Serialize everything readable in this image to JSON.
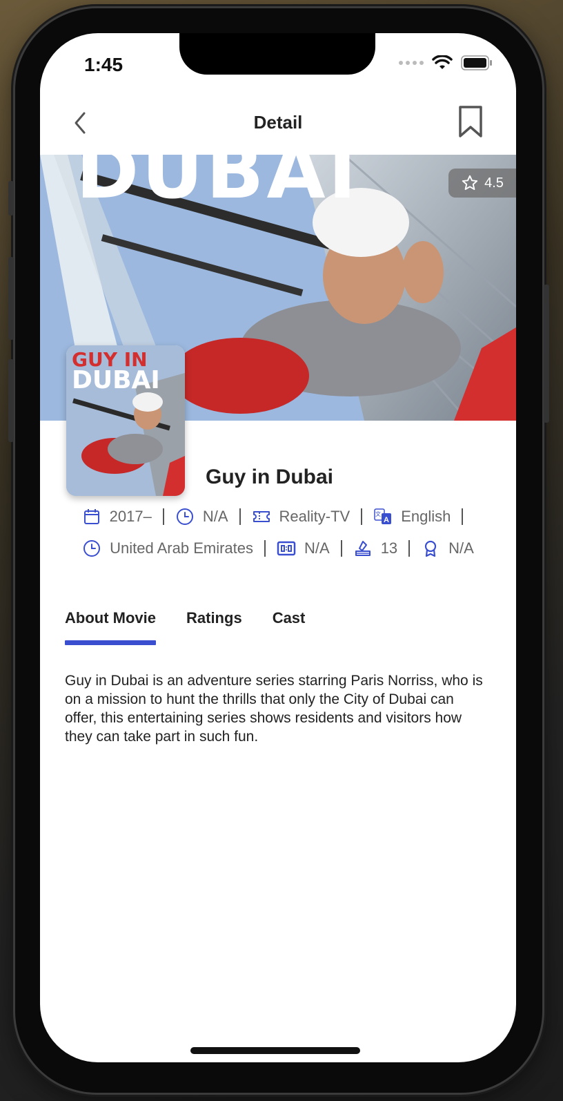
{
  "status": {
    "time": "1:45"
  },
  "nav": {
    "title": "Detail",
    "back_icon": "chevron-left-icon",
    "bookmark_icon": "bookmark-icon"
  },
  "hero": {
    "banner_text": "DUBAI"
  },
  "rating": {
    "value": "4.5",
    "icon": "star-outline-icon"
  },
  "poster": {
    "line1_red": "GUY",
    "line1_white": "IN",
    "line2": "DUBAI"
  },
  "show": {
    "title": "Guy in Dubai"
  },
  "meta": {
    "year": "2017–",
    "runtime": "N/A",
    "genre": "Reality-TV",
    "language": "English",
    "country": "United Arab Emirates",
    "score": "N/A",
    "votes": "13",
    "awards": "N/A"
  },
  "tabs": [
    {
      "label": "About Movie",
      "active": true
    },
    {
      "label": "Ratings",
      "active": false
    },
    {
      "label": "Cast",
      "active": false
    }
  ],
  "about": {
    "text": "Guy in Dubai is an adventure series starring Paris Norriss, who is on a mission to hunt the thrills that only the City of Dubai can offer, this entertaining series shows residents and visitors how they can take part in such fun."
  },
  "colors": {
    "accent": "#3a4fcf",
    "meta_text": "#666666",
    "title_text": "#222222"
  }
}
